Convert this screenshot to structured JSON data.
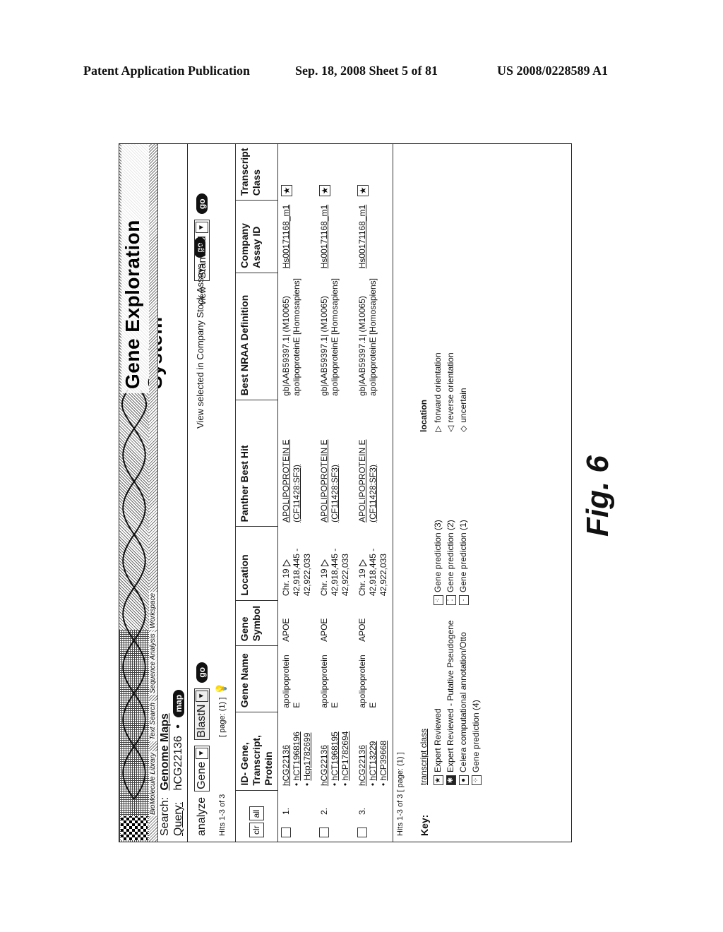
{
  "publication": {
    "left": "Patent Application Publication",
    "middle": "Sep. 18, 2008   Sheet 5 of 81",
    "right": "US 2008/0228589 A1"
  },
  "app": {
    "title": "Gene Exploration System",
    "nav": [
      "BioMolecule Library",
      "Text Search",
      "Sequence Analysis",
      "Workspace"
    ]
  },
  "search": {
    "label": "Search:",
    "value": "Genome Maps"
  },
  "query": {
    "label": "Query:",
    "value": "hCG22136",
    "bullet": "•",
    "map_button": "map"
  },
  "analyze": {
    "label": "analyze",
    "type_select": "Gene",
    "method_select": "BlastN",
    "go_button": "go"
  },
  "view_selected": {
    "label": "View selected in Company Stock Assays",
    "go_button": "go"
  },
  "view": {
    "label": "view",
    "select": "Standard",
    "go_button": "go"
  },
  "hits_top": "Hits 1-3 of 3",
  "page_top": "[ page: (1) ]",
  "table": {
    "clr_button": "clr",
    "all_button": "all",
    "headers": [
      "ID- Gene, Transcript, Protein",
      "Gene Name",
      "Gene Symbol",
      "Location",
      "Panther Best Hit",
      "Best NRAA Definition",
      "Company Assay ID",
      "Transcript Class"
    ],
    "rows": [
      {
        "num": "1.",
        "gene_id": "hCG22136",
        "transcript": "hCT1968196",
        "protein": "Hcp1782699",
        "gene_name": "apolipoprotein E",
        "symbol": "APOE",
        "chr": "Chr. 19",
        "range": "42,918,445 - 42,922,033",
        "panther1": "APOLIPOPROTEIN E",
        "panther2": "(CF11428:SF3)",
        "nraa1": "gb|AAB59397.1| (M10065)",
        "nraa2": "apolipoproteinE [Homosapiens]",
        "assay": "Hs00171168_m1",
        "class_icon": "★"
      },
      {
        "num": "2.",
        "gene_id": "hCG22136",
        "transcript": "hCT1968195",
        "protein": "hCP1782694",
        "gene_name": "apolipoprotein E",
        "symbol": "APOE",
        "chr": "Chr. 19",
        "range": "42,918,445 - 42,922,033",
        "panther1": "APOLIPOPROTEIN E",
        "panther2": "(CF11428:SF3)",
        "nraa1": "gb|AAB59397.1| (M10065)",
        "nraa2": "apolipoproteinE [Homosapiens]",
        "assay": "Hs00171168_m1",
        "class_icon": "★"
      },
      {
        "num": "3.",
        "gene_id": "hCG22136",
        "transcript": "hCT13229",
        "protein": "hCP39668",
        "gene_name": "apolipoprotein E",
        "symbol": "APOE",
        "chr": "Chr. 19",
        "range": "42,918,445 - 42,922,033",
        "panther1": "APOLIPOPROTEIN E",
        "panther2": "(CF11428:SF3)",
        "nraa1": "gb|AAB59397.1| (M10065)",
        "nraa2": "apolipoproteinE [Homosapiens]",
        "assay": "Hs00171168_m1",
        "class_icon": "★"
      }
    ]
  },
  "hits_bottom": "Hits 1-3 of 3  [ page: (1) ]",
  "key": {
    "label": "Key:",
    "transcript_class_title": "transcript class",
    "transcript_class": [
      {
        "icon": "★",
        "label": "Expert Reviewed"
      },
      {
        "icon": "✱",
        "label": "Expert Reviewed - Putative Pseudogene"
      },
      {
        "icon": "●",
        "label": "Celera computational annotation/Otto"
      },
      {
        "icon": "⁘",
        "label": "Gene prediction (4)"
      }
    ],
    "gene_prediction": [
      {
        "icon": "⁖",
        "label": "Gene prediction (3)"
      },
      {
        "icon": "⁚",
        "label": "Gene prediction (2)"
      },
      {
        "icon": "·",
        "label": "Gene prediction (1)"
      }
    ],
    "location_title": "location",
    "location": [
      {
        "icon": "▷",
        "label": "forward orientation"
      },
      {
        "icon": "◁",
        "label": "reverse orientation"
      },
      {
        "icon": "◇",
        "label": "uncertain"
      }
    ]
  },
  "figure_label": "Fig. 6"
}
